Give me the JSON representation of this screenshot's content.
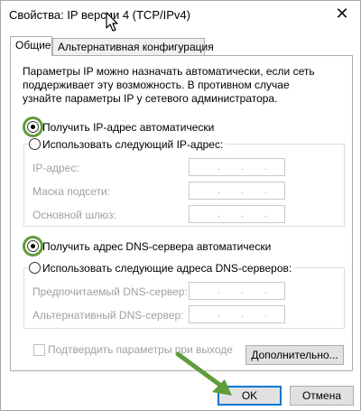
{
  "window": {
    "title": "Свойства: IP версии 4 (TCP/IPv4)",
    "close_glyph": "✕"
  },
  "tabs": [
    {
      "label": "Общие",
      "active": true
    },
    {
      "label": "Альтернативная конфигурация",
      "active": false
    }
  ],
  "description": "Параметры IP можно назначать автоматически, если сеть поддерживает эту возможность. В противном случае узнайте параметры IP у сетевого администратора.",
  "ip_section": {
    "auto_label": "Получить IP-адрес автоматически",
    "manual_label": "Использовать следующий IP-адрес:",
    "selected": "auto",
    "fields": [
      {
        "label": "IP-адрес:",
        "value": ". . ."
      },
      {
        "label": "Маска подсети:",
        "value": ". . ."
      },
      {
        "label": "Основной шлюз:",
        "value": ". . ."
      }
    ]
  },
  "dns_section": {
    "auto_label": "Получить адрес DNS-сервера автоматически",
    "manual_label": "Использовать следующие адреса DNS-серверов:",
    "selected": "auto",
    "fields": [
      {
        "label": "Предпочитаемый DNS-сервер:",
        "value": ". . ."
      },
      {
        "label": "Альтернативный DNS-сервер:",
        "value": ". . ."
      }
    ]
  },
  "validate_checkbox": {
    "label": "Подтвердить параметры при выходе",
    "checked": false
  },
  "buttons": {
    "advanced": "Дополнительно...",
    "ok": "OK",
    "cancel": "Отмена"
  },
  "colors": {
    "highlight_ring": "#5f9c3a",
    "arrow": "#5f9c3a",
    "focus_border": "#0078d7"
  },
  "icons": {
    "close": "close-icon",
    "cursor": "mouse-cursor-icon",
    "arrow": "pointer-arrow-icon"
  }
}
